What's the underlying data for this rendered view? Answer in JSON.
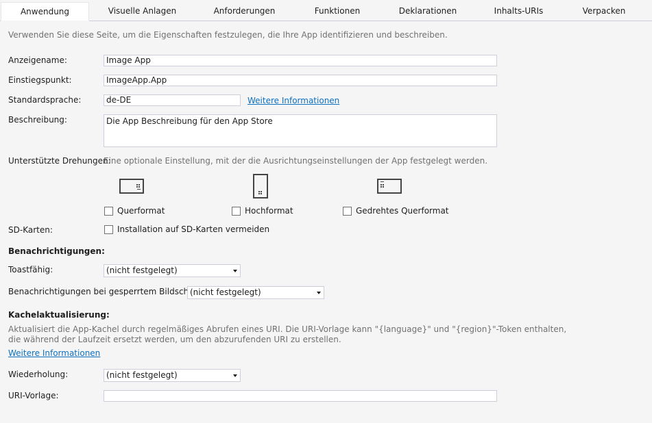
{
  "tabs": [
    {
      "label": "Anwendung",
      "active": true
    },
    {
      "label": "Visuelle Anlagen"
    },
    {
      "label": "Anforderungen"
    },
    {
      "label": "Funktionen"
    },
    {
      "label": "Deklarationen"
    },
    {
      "label": "Inhalts-URIs"
    },
    {
      "label": "Verpacken"
    }
  ],
  "intro": "Verwenden Sie diese Seite, um die Eigenschaften festzulegen, die Ihre App identifizieren und beschreiben.",
  "display_name": {
    "label": "Anzeigename:",
    "value": "Image App"
  },
  "entry_point": {
    "label": "Einstiegspunkt:",
    "value": "ImageApp.App"
  },
  "default_language": {
    "label": "Standardsprache:",
    "value": "de-DE",
    "link": "Weitere Informationen"
  },
  "description": {
    "label": "Beschreibung:",
    "value": "Die App Beschreibung für den App Store"
  },
  "rotations": {
    "label": "Unterstützte Drehungen:",
    "hint": "Eine optionale Einstellung, mit der die Ausrichtungseinstellungen der App festgelegt werden.",
    "options": [
      {
        "label": "Querformat",
        "icon": "landscape-device-icon",
        "checked": false
      },
      {
        "label": "Hochformat",
        "icon": "portrait-device-icon",
        "checked": false
      },
      {
        "label": "Gedrehtes Querformat",
        "icon": "landscape-flipped-device-icon",
        "checked": false
      }
    ]
  },
  "sd_cards": {
    "label": "SD-Karten:",
    "checkbox_label": "Installation auf SD-Karten vermeiden",
    "checked": false
  },
  "notifications": {
    "heading": "Benachrichtigungen:",
    "toast_label": "Toastfähig:",
    "toast_value": "(nicht festgelegt)",
    "lock_label": "Benachrichtigungen bei gesperrtem Bildschirm:",
    "lock_value": "(nicht festgelegt)"
  },
  "tile_update": {
    "heading": "Kachelaktualisierung:",
    "desc_line1": "Aktualisiert die App-Kachel durch regelmäßiges Abrufen eines URI. Die URI-Vorlage kann \"{language}\" und \"{region}\"-Token enthalten,",
    "desc_line2": "die während der Laufzeit ersetzt werden, um den abzurufenden URI zu erstellen.",
    "link": "Weitere Informationen",
    "recurrence_label": "Wiederholung:",
    "recurrence_value": "(nicht festgelegt)",
    "uri_label": "URI-Vorlage:",
    "uri_value": ""
  },
  "colors": {
    "link": "#0e70c0",
    "border": "#cccedb",
    "background": "#f5f5f5"
  }
}
